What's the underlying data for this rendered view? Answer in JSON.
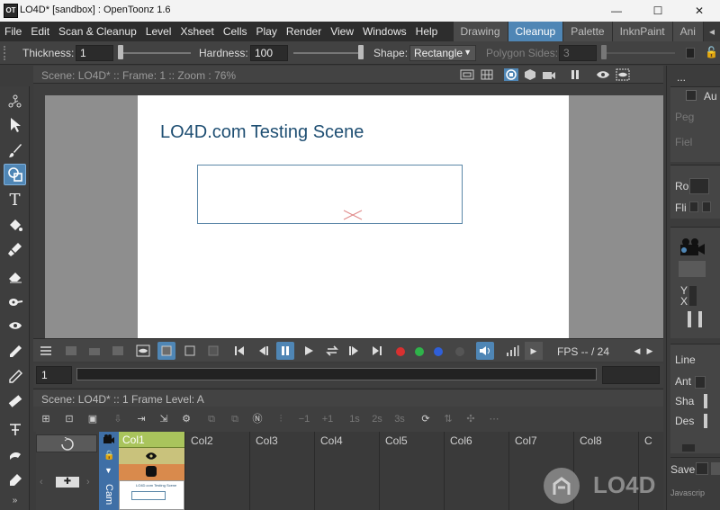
{
  "window": {
    "title": "LO4D* [sandbox] : OpenToonz 1.6",
    "app_icon_label": "OT",
    "buttons": [
      "—",
      "☐",
      "✕"
    ]
  },
  "menu": [
    "File",
    "Edit",
    "Scan & Cleanup",
    "Level",
    "Xsheet",
    "Cells",
    "Play",
    "Render",
    "View",
    "Windows",
    "Help"
  ],
  "rooms": [
    {
      "label": "Drawing",
      "active": false
    },
    {
      "label": "Cleanup",
      "active": true
    },
    {
      "label": "Palette",
      "active": false
    },
    {
      "label": "InknPaint",
      "active": false
    },
    {
      "label": "Ani",
      "active": false
    }
  ],
  "tool_options": {
    "thickness_label": "Thickness:",
    "thickness_value": "1",
    "hardness_label": "Hardness:",
    "hardness_value": "100",
    "shape_label": "Shape:",
    "shape_value": "Rectangle",
    "polygon_sides_label": "Polygon Sides:",
    "polygon_sides_value": "3"
  },
  "viewer": {
    "header": "Scene: LO4D*  ::  Frame: 1  ::  Zoom : 76%",
    "scene_title": "LO4D.com Testing Scene"
  },
  "playback": {
    "fps": "FPS -- / 24",
    "colors": [
      "#d83030",
      "#2fb34a",
      "#2f5fd8",
      "#555555"
    ]
  },
  "frame": {
    "value": "1"
  },
  "xsheet": {
    "header": "Scene: LO4D*  ::  1 Frame  Level: A",
    "columns": [
      "Col1",
      "Col2",
      "Col3",
      "Col4",
      "Col5",
      "Col6",
      "Col7",
      "Col8",
      "C"
    ],
    "camera_label": "Cam"
  },
  "right_panel": {
    "labels": [
      "...",
      "Au",
      "Peg",
      "Fiel",
      "Ro",
      "Fli",
      "Y",
      "X",
      "Line",
      "Ant",
      "Sha",
      "Des",
      "Save"
    ],
    "save_sub": "Javascrip"
  },
  "watermark": {
    "text": "LO4D"
  },
  "accent": "#4f86b5"
}
